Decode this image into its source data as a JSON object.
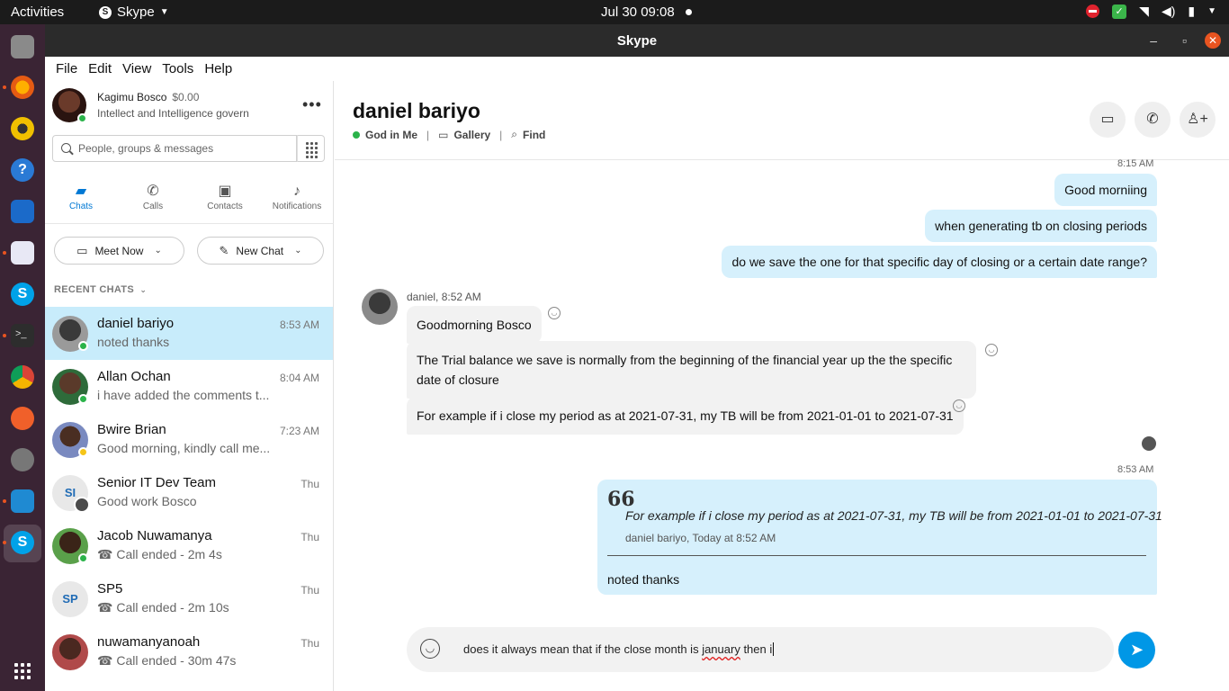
{
  "topbar": {
    "activities": "Activities",
    "app_name": "Skype",
    "clock": "Jul 30  09:08"
  },
  "window": {
    "title": "Skype",
    "minimize": "–",
    "maximize": "▫",
    "close": "✕"
  },
  "menu": [
    "File",
    "Edit",
    "View",
    "Tools",
    "Help"
  ],
  "profile": {
    "name": "Kagimu Bosco",
    "credit": "$0.00",
    "mood": "Intellect and Intelligence govern",
    "more": "•••"
  },
  "search": {
    "placeholder": "People, groups & messages"
  },
  "tabs": [
    {
      "label": "Chats",
      "icon": "chat-icon"
    },
    {
      "label": "Calls",
      "icon": "phone-icon"
    },
    {
      "label": "Contacts",
      "icon": "contacts-icon"
    },
    {
      "label": "Notifications",
      "icon": "bell-icon"
    }
  ],
  "actions": {
    "meet_now": "Meet Now",
    "new_chat": "New Chat"
  },
  "recent_label": "RECENT CHATS",
  "chats": [
    {
      "name": "daniel bariyo",
      "preview": "noted thanks",
      "time": "8:53 AM",
      "initials": ""
    },
    {
      "name": "Allan Ochan",
      "preview": "i have added the comments t...",
      "time": "8:04 AM",
      "initials": ""
    },
    {
      "name": "Bwire Brian",
      "preview": "Good morning, kindly call me...",
      "time": "7:23 AM",
      "initials": ""
    },
    {
      "name": "Senior IT Dev Team",
      "preview": "Good work Bosco",
      "time": "Thu",
      "initials": "SI"
    },
    {
      "name": "Jacob Nuwamanya",
      "preview": "Call ended - 2m 4s",
      "time": "Thu",
      "initials": ""
    },
    {
      "name": "SP5",
      "preview": "Call ended - 2m 10s",
      "time": "Thu",
      "initials": "SP"
    },
    {
      "name": "nuwamanyanoah",
      "preview": "Call ended - 30m 47s",
      "time": "Thu",
      "initials": ""
    }
  ],
  "conversation": {
    "title": "daniel bariyo",
    "mood": "God in Me",
    "gallery": "Gallery",
    "find": "Find",
    "messages": {
      "ts1": "8:15 AM",
      "out1": "Good morniing",
      "out2": "when generating tb on closing periods",
      "out3": "do we save the one for that specific day of closing or a certain date range?",
      "sender": "daniel, 8:52 AM",
      "in1": "Goodmorning Bosco",
      "in2": "The Trial balance we save is normally from the beginning of the financial year up the the specific date of closure",
      "in3": "For example if i close my period as at 2021-07-31, my TB will be from 2021-01-01 to 2021-07-31",
      "ts2": "8:53 AM",
      "quote_text": "For example if i close my period as at 2021-07-31, my TB will be from 2021-01-01 to 2021-07-31",
      "quote_meta": "daniel bariyo, Today at 8:52 AM",
      "reply": "noted thanks"
    },
    "composer": {
      "text_before": "does it always mean that if the close month is ",
      "text_misspelled": "january",
      "text_after": " then i"
    }
  }
}
